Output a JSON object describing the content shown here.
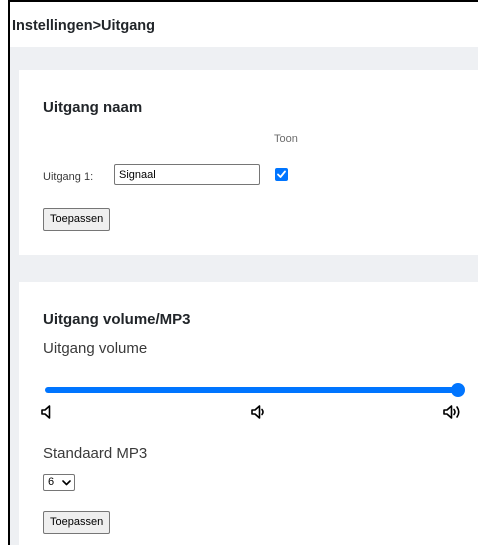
{
  "breadcrumb": "Instellingen>Uitgang",
  "output_name_section": {
    "title": "Uitgang naam",
    "show_header": "Toon",
    "rows": [
      {
        "label": "Uitgang 1:",
        "value": "Signaal",
        "show_checked": true
      }
    ],
    "apply_label": "Toepassen"
  },
  "volume_section": {
    "title": "Uitgang volume/MP3",
    "volume_label": "Uitgang volume",
    "volume_level_percent": 100,
    "icons": [
      "volume-mute-icon",
      "volume-low-icon",
      "volume-high-icon"
    ],
    "mp3_label": "Standaard MP3",
    "mp3_selected": "6",
    "apply_label": "Toepassen"
  },
  "colors": {
    "accent": "#0075ff",
    "page_background": "#eef0f3",
    "card_background": "#ffffff",
    "text": "#212529"
  }
}
